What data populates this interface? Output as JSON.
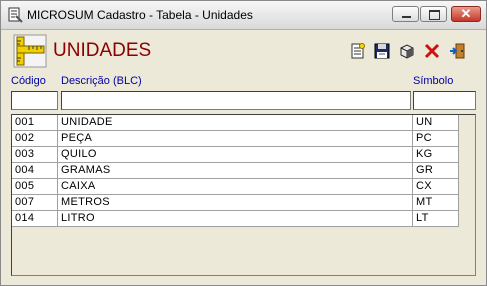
{
  "window": {
    "title": "MICROSUM Cadastro - Tabela - Unidades"
  },
  "header": {
    "title": "UNIDADES"
  },
  "toolbar": {
    "buttons": [
      {
        "name": "new-document-icon"
      },
      {
        "name": "save-disk-icon"
      },
      {
        "name": "package-icon"
      },
      {
        "name": "delete-x-icon"
      },
      {
        "name": "exit-door-icon"
      }
    ]
  },
  "columns": {
    "code": "Código",
    "description": "Descrição (BLC)",
    "symbol": "Símbolo"
  },
  "filters": {
    "code": "",
    "description": "",
    "symbol": ""
  },
  "rows": [
    {
      "code": "001",
      "description": "UNIDADE",
      "symbol": "UN"
    },
    {
      "code": "002",
      "description": "PEÇA",
      "symbol": "PC"
    },
    {
      "code": "003",
      "description": "QUILO",
      "symbol": "KG"
    },
    {
      "code": "004",
      "description": "GRAMAS",
      "symbol": "GR"
    },
    {
      "code": "005",
      "description": "CAIXA",
      "symbol": "CX"
    },
    {
      "code": "007",
      "description": "METROS",
      "symbol": "MT"
    },
    {
      "code": "014",
      "description": "LITRO",
      "symbol": "LT"
    }
  ],
  "colors": {
    "header_title": "#8B0000",
    "column_label": "#0000A0"
  }
}
